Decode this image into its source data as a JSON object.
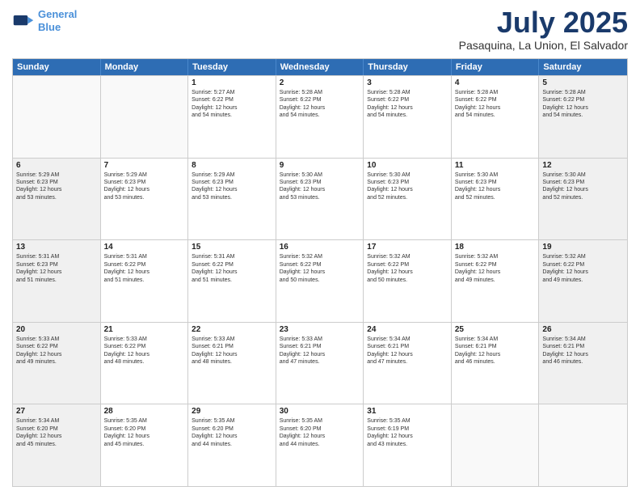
{
  "logo": {
    "line1": "General",
    "line2": "Blue"
  },
  "title": "July 2025",
  "location": "Pasaquina, La Union, El Salvador",
  "days": [
    "Sunday",
    "Monday",
    "Tuesday",
    "Wednesday",
    "Thursday",
    "Friday",
    "Saturday"
  ],
  "weeks": [
    [
      {
        "day": "",
        "info": "",
        "empty": true
      },
      {
        "day": "",
        "info": "",
        "empty": true
      },
      {
        "day": "1",
        "info": "Sunrise: 5:27 AM\nSunset: 6:22 PM\nDaylight: 12 hours\nand 54 minutes."
      },
      {
        "day": "2",
        "info": "Sunrise: 5:28 AM\nSunset: 6:22 PM\nDaylight: 12 hours\nand 54 minutes."
      },
      {
        "day": "3",
        "info": "Sunrise: 5:28 AM\nSunset: 6:22 PM\nDaylight: 12 hours\nand 54 minutes."
      },
      {
        "day": "4",
        "info": "Sunrise: 5:28 AM\nSunset: 6:22 PM\nDaylight: 12 hours\nand 54 minutes."
      },
      {
        "day": "5",
        "info": "Sunrise: 5:28 AM\nSunset: 6:22 PM\nDaylight: 12 hours\nand 54 minutes."
      }
    ],
    [
      {
        "day": "6",
        "info": "Sunrise: 5:29 AM\nSunset: 6:23 PM\nDaylight: 12 hours\nand 53 minutes."
      },
      {
        "day": "7",
        "info": "Sunrise: 5:29 AM\nSunset: 6:23 PM\nDaylight: 12 hours\nand 53 minutes."
      },
      {
        "day": "8",
        "info": "Sunrise: 5:29 AM\nSunset: 6:23 PM\nDaylight: 12 hours\nand 53 minutes."
      },
      {
        "day": "9",
        "info": "Sunrise: 5:30 AM\nSunset: 6:23 PM\nDaylight: 12 hours\nand 53 minutes."
      },
      {
        "day": "10",
        "info": "Sunrise: 5:30 AM\nSunset: 6:23 PM\nDaylight: 12 hours\nand 52 minutes."
      },
      {
        "day": "11",
        "info": "Sunrise: 5:30 AM\nSunset: 6:23 PM\nDaylight: 12 hours\nand 52 minutes."
      },
      {
        "day": "12",
        "info": "Sunrise: 5:30 AM\nSunset: 6:23 PM\nDaylight: 12 hours\nand 52 minutes."
      }
    ],
    [
      {
        "day": "13",
        "info": "Sunrise: 5:31 AM\nSunset: 6:23 PM\nDaylight: 12 hours\nand 51 minutes."
      },
      {
        "day": "14",
        "info": "Sunrise: 5:31 AM\nSunset: 6:22 PM\nDaylight: 12 hours\nand 51 minutes."
      },
      {
        "day": "15",
        "info": "Sunrise: 5:31 AM\nSunset: 6:22 PM\nDaylight: 12 hours\nand 51 minutes."
      },
      {
        "day": "16",
        "info": "Sunrise: 5:32 AM\nSunset: 6:22 PM\nDaylight: 12 hours\nand 50 minutes."
      },
      {
        "day": "17",
        "info": "Sunrise: 5:32 AM\nSunset: 6:22 PM\nDaylight: 12 hours\nand 50 minutes."
      },
      {
        "day": "18",
        "info": "Sunrise: 5:32 AM\nSunset: 6:22 PM\nDaylight: 12 hours\nand 49 minutes."
      },
      {
        "day": "19",
        "info": "Sunrise: 5:32 AM\nSunset: 6:22 PM\nDaylight: 12 hours\nand 49 minutes."
      }
    ],
    [
      {
        "day": "20",
        "info": "Sunrise: 5:33 AM\nSunset: 6:22 PM\nDaylight: 12 hours\nand 49 minutes."
      },
      {
        "day": "21",
        "info": "Sunrise: 5:33 AM\nSunset: 6:22 PM\nDaylight: 12 hours\nand 48 minutes."
      },
      {
        "day": "22",
        "info": "Sunrise: 5:33 AM\nSunset: 6:21 PM\nDaylight: 12 hours\nand 48 minutes."
      },
      {
        "day": "23",
        "info": "Sunrise: 5:33 AM\nSunset: 6:21 PM\nDaylight: 12 hours\nand 47 minutes."
      },
      {
        "day": "24",
        "info": "Sunrise: 5:34 AM\nSunset: 6:21 PM\nDaylight: 12 hours\nand 47 minutes."
      },
      {
        "day": "25",
        "info": "Sunrise: 5:34 AM\nSunset: 6:21 PM\nDaylight: 12 hours\nand 46 minutes."
      },
      {
        "day": "26",
        "info": "Sunrise: 5:34 AM\nSunset: 6:21 PM\nDaylight: 12 hours\nand 46 minutes."
      }
    ],
    [
      {
        "day": "27",
        "info": "Sunrise: 5:34 AM\nSunset: 6:20 PM\nDaylight: 12 hours\nand 45 minutes."
      },
      {
        "day": "28",
        "info": "Sunrise: 5:35 AM\nSunset: 6:20 PM\nDaylight: 12 hours\nand 45 minutes."
      },
      {
        "day": "29",
        "info": "Sunrise: 5:35 AM\nSunset: 6:20 PM\nDaylight: 12 hours\nand 44 minutes."
      },
      {
        "day": "30",
        "info": "Sunrise: 5:35 AM\nSunset: 6:20 PM\nDaylight: 12 hours\nand 44 minutes."
      },
      {
        "day": "31",
        "info": "Sunrise: 5:35 AM\nSunset: 6:19 PM\nDaylight: 12 hours\nand 43 minutes."
      },
      {
        "day": "",
        "info": "",
        "empty": true
      },
      {
        "day": "",
        "info": "",
        "empty": true
      }
    ]
  ]
}
